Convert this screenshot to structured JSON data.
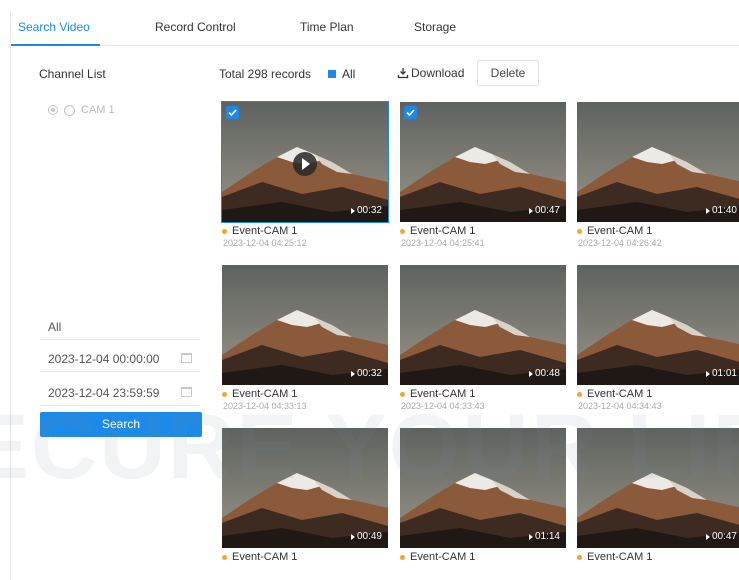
{
  "tabs": [
    {
      "label": "Search Video",
      "active": true
    },
    {
      "label": "Record Control",
      "active": false
    },
    {
      "label": "Time Plan",
      "active": false
    },
    {
      "label": "Storage",
      "active": false
    }
  ],
  "sidebar": {
    "title": "Channel List",
    "channel": "CAM 1",
    "type_value": "All",
    "start_time": "2023-12-04 00:00:00",
    "end_time": "2023-12-04 23:59:59",
    "search_label": "Search"
  },
  "toolbar": {
    "total": "Total 298 records",
    "all_label": "All",
    "download_label": "Download",
    "delete_label": "Delete"
  },
  "records": [
    {
      "name": "Event-CAM 1",
      "time": "2023-12-04 04:25:12",
      "duration": "00:32",
      "checked": true,
      "selected": true,
      "playing": true
    },
    {
      "name": "Event-CAM 1",
      "time": "2023-12-04 04:25:41",
      "duration": "00:47",
      "checked": true,
      "selected": false,
      "playing": false
    },
    {
      "name": "Event-CAM 1",
      "time": "2023-12-04 04:26:42",
      "duration": "01:40",
      "checked": false,
      "selected": false,
      "playing": false
    },
    {
      "name": "Event-CAM 1",
      "time": "2023-12-04 04:33:13",
      "duration": "00:32",
      "checked": false,
      "selected": false,
      "playing": false
    },
    {
      "name": "Event-CAM 1",
      "time": "2023-12-04 04:33:43",
      "duration": "00:48",
      "checked": false,
      "selected": false,
      "playing": false
    },
    {
      "name": "Event-CAM 1",
      "time": "2023-12-04 04:34:43",
      "duration": "01:01",
      "checked": false,
      "selected": false,
      "playing": false
    },
    {
      "name": "Event-CAM 1",
      "time": "",
      "duration": "00:49",
      "checked": false,
      "selected": false,
      "playing": false
    },
    {
      "name": "Event-CAM 1",
      "time": "",
      "duration": "01:14",
      "checked": false,
      "selected": false,
      "playing": false
    },
    {
      "name": "Event-CAM 1",
      "time": "",
      "duration": "00:47",
      "checked": false,
      "selected": false,
      "playing": false
    }
  ],
  "watermark": "SECURE YOUR LIFE",
  "colors": {
    "accent": "#1e88e5",
    "event_dot": "#f5a623"
  }
}
